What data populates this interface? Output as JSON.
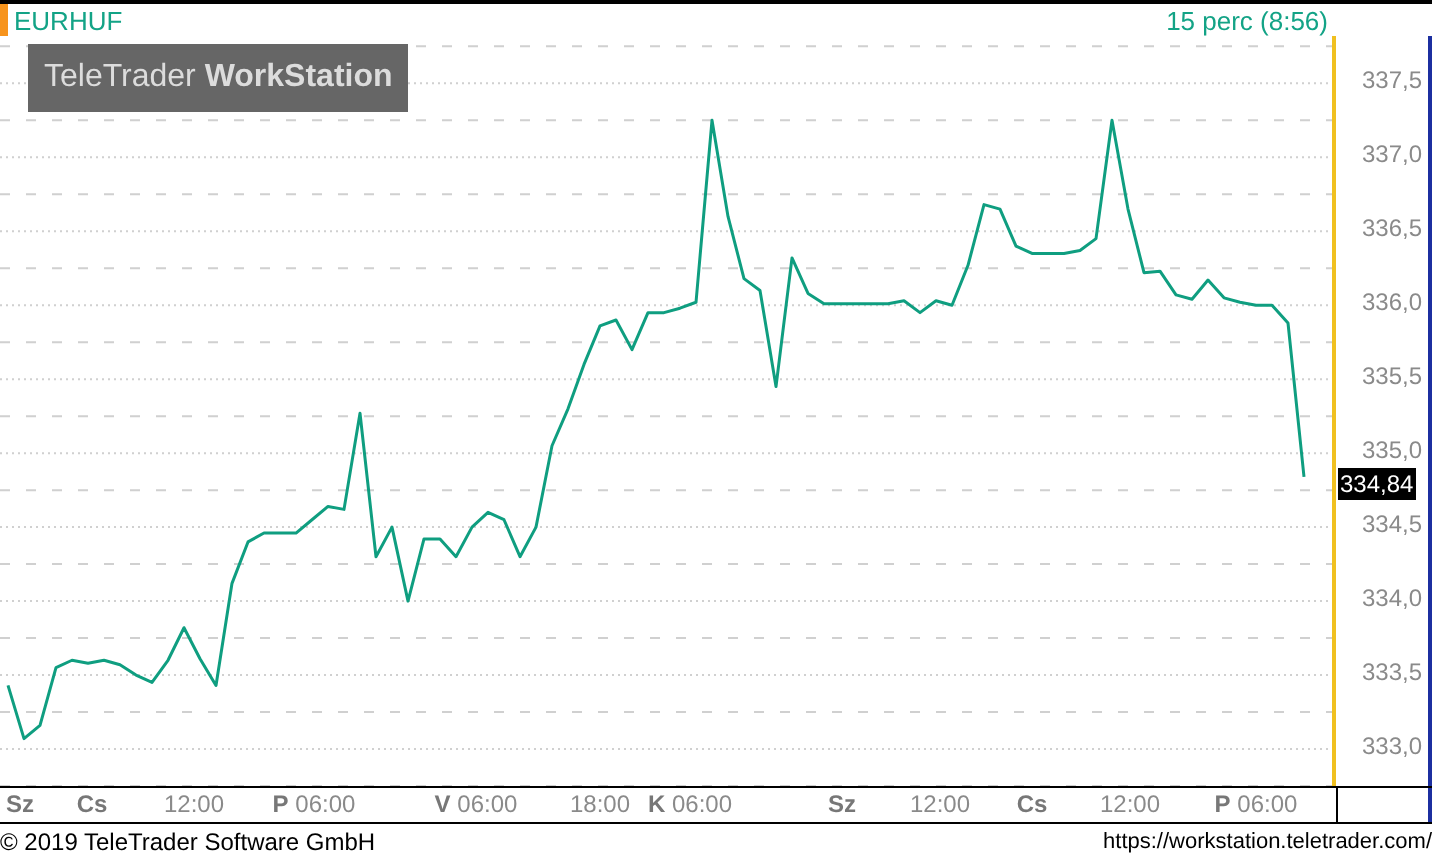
{
  "header": {
    "interval": "15 perc (8:56)"
  },
  "logo": "TeleTrader **WorkStation**",
  "chart": {
    "chart_data": {
      "type": "line",
      "grid": true,
      "ylim": [
        332.75,
        337.82
      ],
      "yticks": [
        {
          "value": 333,
          "label": "333,0"
        },
        {
          "value": 333.5,
          "label": "333,5"
        },
        {
          "value": 334,
          "label": "334,0"
        },
        {
          "value": 334.5,
          "label": "334,5"
        },
        {
          "value": 335,
          "label": "335,0"
        },
        {
          "value": 335.5,
          "label": "335,5"
        },
        {
          "value": 336,
          "label": "336,0"
        },
        {
          "value": 336.5,
          "label": "336,5"
        },
        {
          "value": 337,
          "label": "337,0"
        },
        {
          "value": 337.5,
          "label": "337,5"
        }
      ],
      "series": [
        {
          "name": "EURHUF",
          "color": "#0f9e80",
          "values": [
            333.43,
            333.07,
            333.16,
            333.55,
            333.6,
            333.58,
            333.6,
            333.57,
            333.5,
            333.45,
            333.6,
            333.82,
            333.61,
            333.43,
            334.12,
            334.4,
            334.46,
            334.46,
            334.46,
            334.55,
            334.64,
            334.62,
            335.27,
            334.3,
            334.5,
            334.0,
            334.42,
            334.42,
            334.3,
            334.5,
            334.6,
            334.55,
            334.3,
            334.5,
            335.05,
            335.3,
            335.6,
            335.86,
            335.9,
            335.7,
            335.95,
            335.95,
            335.98,
            336.02,
            337.25,
            336.6,
            336.18,
            336.1,
            335.45,
            336.32,
            336.08,
            336.01,
            336.01,
            336.01,
            336.01,
            336.01,
            336.03,
            335.95,
            336.03,
            336.0,
            336.27,
            336.68,
            336.65,
            336.4,
            336.35,
            336.35,
            336.35,
            336.37,
            336.45,
            337.25,
            336.65,
            336.22,
            336.23,
            336.07,
            336.04,
            336.17,
            336.05,
            336.02,
            336.0,
            336.0,
            335.88,
            334.84
          ]
        }
      ]
    },
    "last_price": "334,84",
    "time_axis": [
      "**Sz**",
      "**Cs**",
      "12:00",
      "**P** 06:00",
      "**V** 06:00",
      "18:00",
      "**K** 06:00",
      "**Sz**",
      "12:00",
      "**Cs**",
      "12:00",
      "**P** 06:00"
    ]
  },
  "footer": {
    "copyright": "© 2019 TeleTrader Software GmbH",
    "url": "https://workstation.teletrader.com/"
  }
}
